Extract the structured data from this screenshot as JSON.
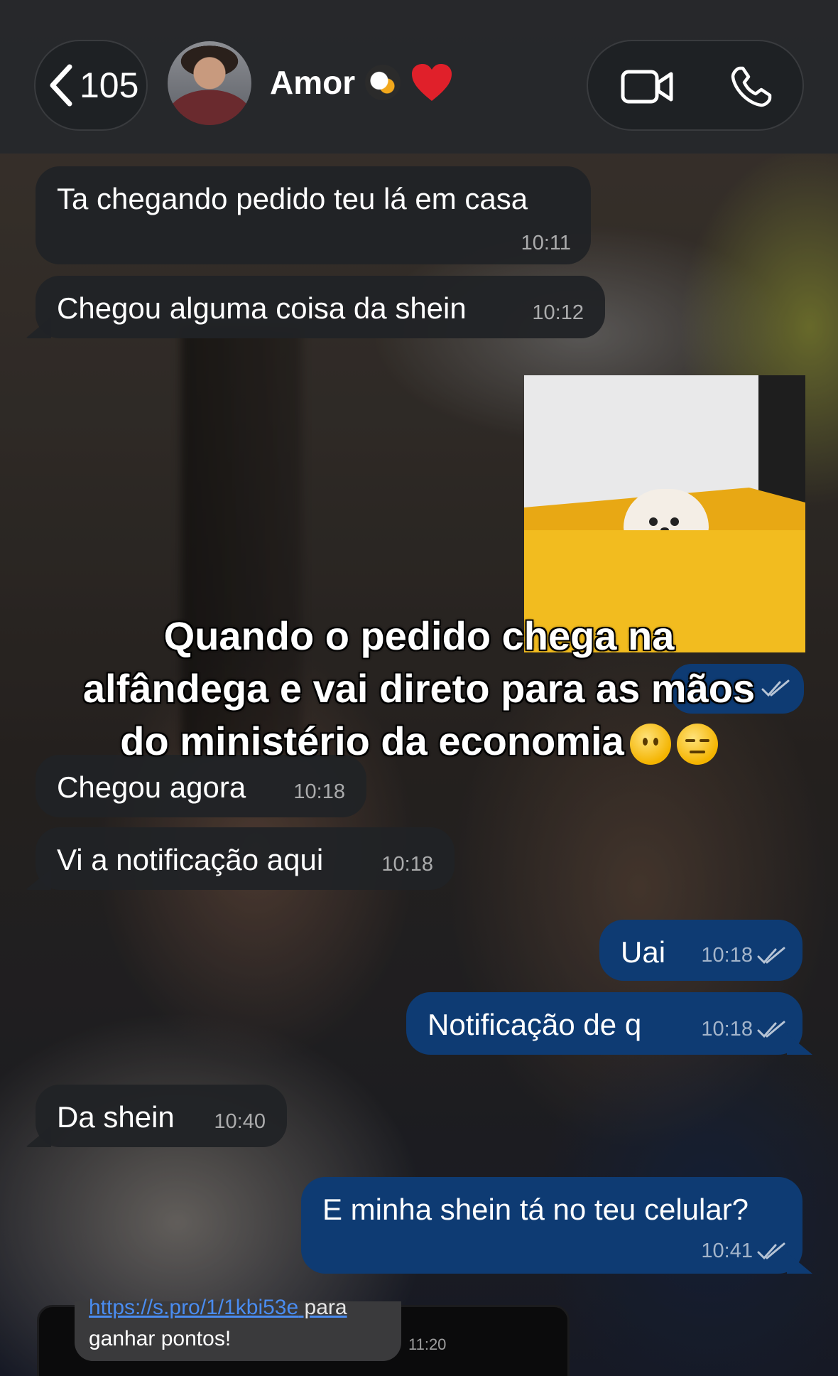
{
  "header": {
    "back_count": "105",
    "contact_name": "Amor",
    "icons": {
      "back": "chevron-left-icon",
      "video": "video-camera-icon",
      "phone": "phone-icon",
      "penguin_emoji": "penguin-emoji",
      "heart_emoji": "red-heart-emoji"
    }
  },
  "messages": [
    {
      "direction": "in",
      "text": "Ta chegando pedido teu lá em casa",
      "time": "10:11"
    },
    {
      "direction": "in",
      "text": "Chegou alguma coisa da shein",
      "time": "10:12"
    },
    {
      "direction": "out",
      "type": "image",
      "description": "image-message"
    },
    {
      "direction": "in",
      "text": "Chegou agora",
      "time": "10:18"
    },
    {
      "direction": "in",
      "text": "Vi a notificação aqui",
      "time": "10:18"
    },
    {
      "direction": "out",
      "text": "Uai",
      "time": "10:18",
      "status": "read"
    },
    {
      "direction": "out",
      "text": "Notificação de q",
      "time": "10:18",
      "status": "read"
    },
    {
      "direction": "in",
      "text": "Da shein",
      "time": "10:40"
    },
    {
      "direction": "out",
      "text": "E minha shein tá no teu celular?",
      "time": "10:41",
      "status": "read"
    }
  ],
  "overlay": {
    "line1": "Quando o pedido chega na",
    "line2": "alfândega e vai direto para as mãos",
    "line3": "do ministério da economia"
  },
  "bottom_snippet": {
    "link": "https://s.pro/1/1kbi53e",
    "link_suffix": " para",
    "text": "ganhar pontos!",
    "time": "11:20"
  },
  "colors": {
    "incoming_bubble": "#212326",
    "outgoing_bubble": "#0e3b73",
    "header_bg": "#26282b"
  }
}
